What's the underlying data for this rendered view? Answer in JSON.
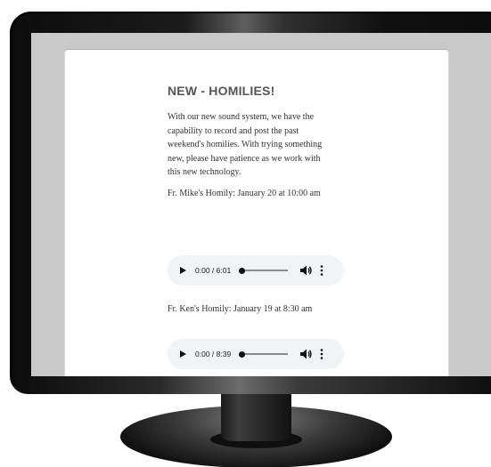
{
  "article": {
    "heading": "NEW - HOMILIES!",
    "intro": "With our new sound system, we have the capability to record and post the past weekend's homilies. With trying something new, please have patience as we work with this new technology.",
    "homilies": [
      {
        "caption": "Fr. Mike's Homily: January 20 at 10:00 am",
        "player": {
          "current_time": "0:00",
          "duration": "6:01",
          "time_display": "0:00 / 6:01",
          "progress": 0
        }
      },
      {
        "caption": "Fr. Ken's Homily: January 19 at 8:30 am",
        "player": {
          "current_time": "0:00",
          "duration": "8:39",
          "time_display": "0:00 / 8:39",
          "progress": 0
        }
      }
    ]
  },
  "icons": {
    "play": "play-icon",
    "volume": "volume-icon",
    "menu": "more-vertical-icon"
  },
  "colors": {
    "heading": "#555555",
    "text": "#333333",
    "player_background": "#f1f3f4",
    "screen_background": "#c9c9c9",
    "bezel": "#111111"
  }
}
